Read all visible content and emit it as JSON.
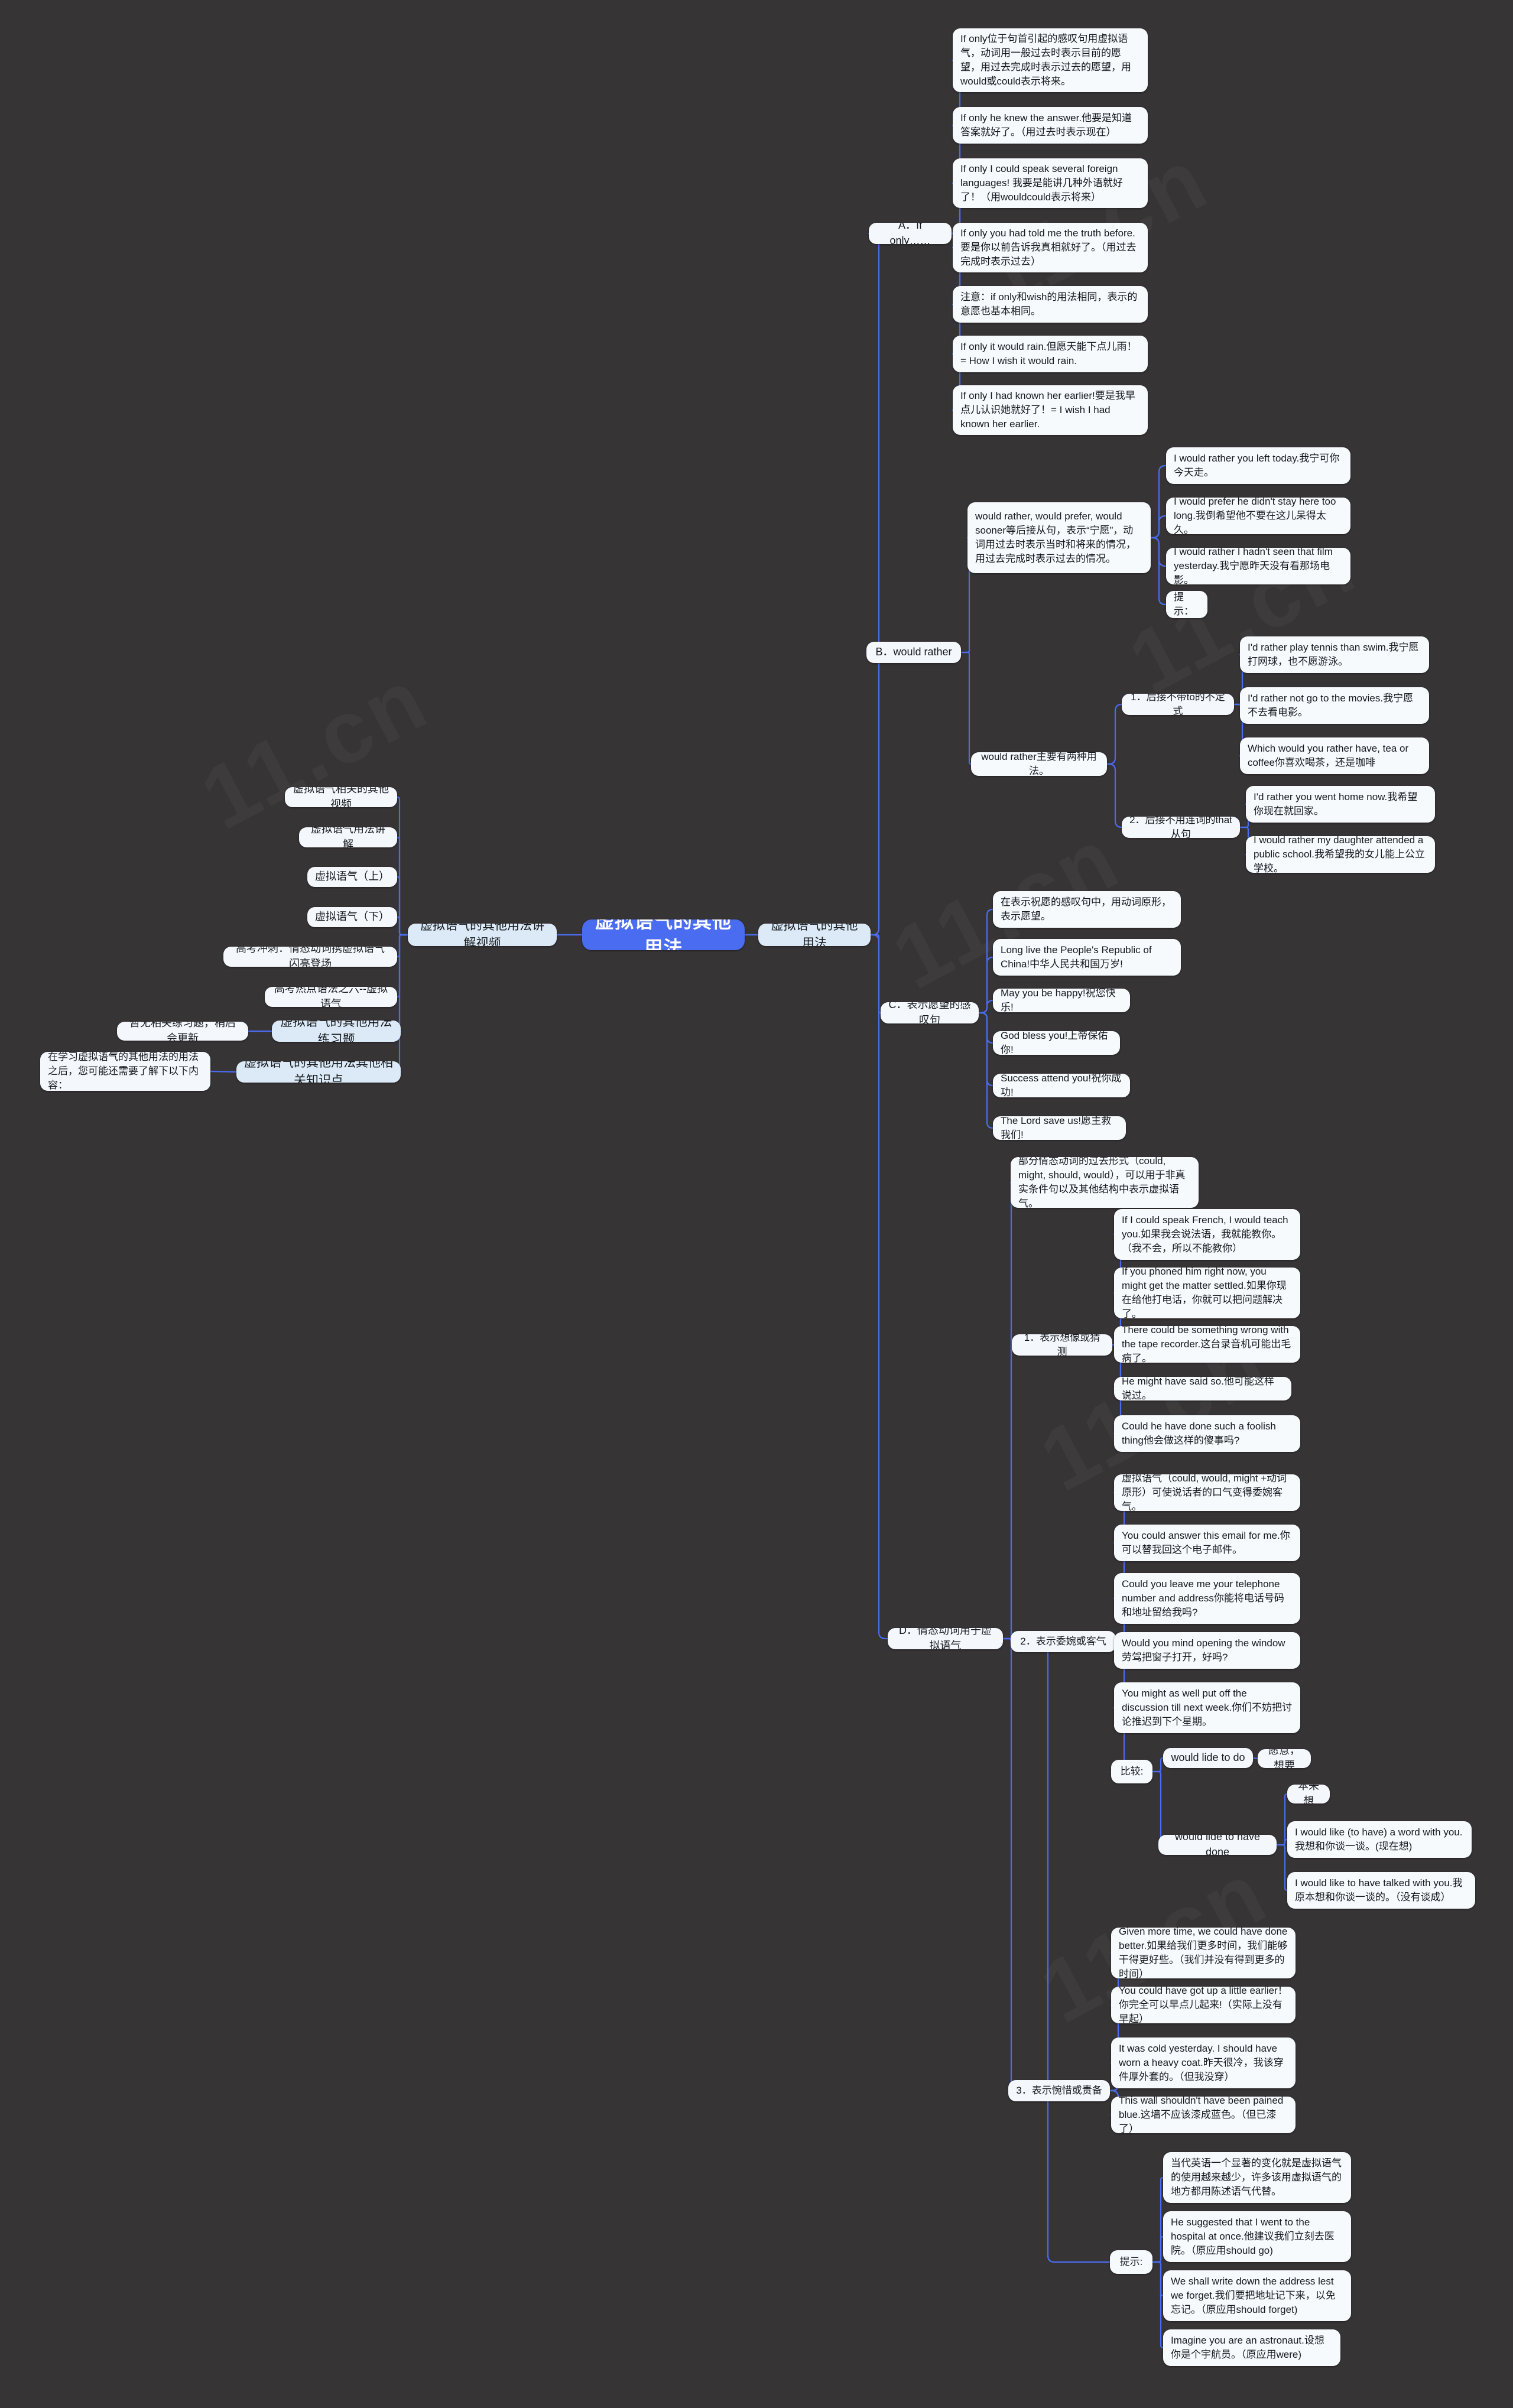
{
  "theme": {
    "background": "#373436",
    "root_fill": "#4a6cf0",
    "root_text": "#ffffff",
    "node_fill": "#f6fafd",
    "lvl1_fill": "#dceaf7",
    "link_color": "#4a6cf0",
    "text_color": "#15181c"
  },
  "watermark": "11.cn",
  "root": {
    "label": "虚拟语气的其他用法"
  },
  "left": {
    "video_hub": {
      "label": "虚拟语气的其他用法讲解视频"
    },
    "videos": [
      {
        "label": "虚拟语气相关的其他视频"
      },
      {
        "label": "虚拟语气用法讲解"
      },
      {
        "label": "虚拟语气（上）"
      },
      {
        "label": "虚拟语气（下）"
      },
      {
        "label": "高考冲刺：情态动词携虚拟语气闪亮登场"
      },
      {
        "label": "高考热点语法之六--虚拟语气"
      }
    ],
    "exercise": {
      "label": "虚拟语气的其他用法练习题",
      "child": "暂无相关练习题，稍后会更新"
    },
    "related": {
      "label": "虚拟语气的其他用法其他相关知识点",
      "child": "在学习虚拟语气的其他用法的用法之后，您可能还需要了解下以下内容："
    }
  },
  "right": {
    "hub": {
      "label": "虚拟语气的其他用法"
    },
    "branches": [
      {
        "id": "A",
        "label": "A．If only……",
        "items": [
          "If only位于句首引起的感叹句用虚拟语气，动词用一般过去时表示目前的愿望，用过去完成时表示过去的愿望，用would或could表示将来。",
          "If only he knew the answer.他要是知道答案就好了。（用过去时表示现在）",
          "If only I could speak several foreign languages! 我要是能讲几种外语就好了！（用wouldcould表示将来）",
          "If only you had told me the truth before.要是你以前告诉我真相就好了。（用过去完成时表示过去）",
          "注意：if only和wish的用法相同，表示的意愿也基本相同。",
          "If only it would rain.但愿天能下点儿雨！= How I wish it would rain.",
          "If only I had known her earlier!要是我早点儿认识她就好了！= I wish I had known her earlier."
        ]
      },
      {
        "id": "B",
        "label": "B．would rather",
        "groups": [
          {
            "label": "would rather, would prefer, would sooner等后接从句，表示“宁愿”，动词用过去时表示当时和将来的情况，用过去完成时表示过去的情况。",
            "items": [
              "I would rather you left today.我宁可你今天走。",
              "I would prefer he didn't stay here too long.我倒希望他不要在这儿呆得太久。",
              "I would rather I hadn't seen that film yesterday.我宁愿昨天没有看那场电影。",
              "提示："
            ]
          },
          {
            "label": "would rather主要有两种用法。",
            "subgroups": [
              {
                "label": "1．后接不带to的不定式",
                "items": [
                  "I'd rather play tennis than swim.我宁愿打网球，也不愿游泳。",
                  "I'd rather not go to the movies.我宁愿不去看电影。",
                  "Which would you rather have, tea or coffee你喜欢喝茶，还是咖啡"
                ]
              },
              {
                "label": "2．后接不用连词的that从句",
                "items": [
                  "I'd rather you went home now.我希望你现在就回家。",
                  "I would rather my daughter attended a public school.我希望我的女儿能上公立学校。"
                ]
              }
            ]
          }
        ]
      },
      {
        "id": "C",
        "label": "C．表示愿望的感叹句",
        "items": [
          "在表示祝愿的感叹句中，用动词原形，表示愿望。",
          "Long live the People's Republic of China!中华人民共和国万岁!",
          "May you be happy!祝您快乐!",
          "God bless you!上帝保佑你!",
          "Success attend you!祝你成功!",
          "The Lord save us!愿主救我们!"
        ]
      },
      {
        "id": "D",
        "label": "D．情态动词用于虚拟语气",
        "intro": "部分情态动词的过去形式（could, might, should, would），可以用于非真实条件句以及其他结构中表示虚拟语气。",
        "groups": [
          {
            "label": "1．表示想像或猜测",
            "items": [
              "If I could speak French, I would teach you.如果我会说法语，我就能教你。（我不会，所以不能教你）",
              "If you phoned him right now, you might get the matter settled.如果你现在给他打电话，你就可以把问题解决了。",
              "There could be something wrong with the tape recorder.这台录音机可能出毛病了。",
              "He might have said so.他可能这样说过。",
              "Could he have done such a foolish thing他会做这样的傻事吗?"
            ]
          },
          {
            "label": "2．表示委婉或客气",
            "items": [
              "虚拟语气（could, would, might +动词原形）可使说话者的口气变得委婉客气。",
              "You could answer this email for me.你可以替我回这个电子邮件。",
              "Could you leave me your telephone number and address你能将电话号码和地址留给我吗?",
              "Would you mind opening the window劳驾把窗子打开，好吗?",
              "You might as well put off the discussion till next week.你们不妨把讨论推迟到下个星期。"
            ],
            "compare": {
              "label": "比较:",
              "pairs": [
                {
                  "form": "would lide to do",
                  "meaning": "愿意，想要",
                  "examples": []
                },
                {
                  "form": "would lide to have done",
                  "meaning": "本来想",
                  "examples": [
                    "I would like (to have) a word with you.我想和你谈一谈。(现在想)",
                    "I would like to have talked with you.我原本想和你谈一谈的。（没有谈成）"
                  ]
                }
              ]
            }
          },
          {
            "label": "3．表示惋惜或责备",
            "items": [
              "Given more time, we could have done better.如果给我们更多时间，我们能够干得更好些。（我们并没有得到更多的时间）",
              "You could have got up a little earlier！你完全可以早点儿起来!（实际上没有早起）",
              "It was cold yesterday. I should have worn a heavy coat.昨天很冷，我该穿件厚外套的。（但我没穿）",
              "This wall shouldn't have been pained blue.这墙不应该漆成蓝色。（但已漆了）"
            ]
          },
          {
            "label": "提示:",
            "items": [
              "当代英语一个显著的变化就是虚拟语气的使用越来越少，许多该用虚拟语气的地方都用陈述语气代替。",
              "He suggested that I went to the hospital at once.他建议我们立刻去医院。（原应用should go)",
              "We shall write down the address lest we forget.我们要把地址记下来，以免忘记。（原应用should forget)",
              "Imagine you are an astronaut.设想你是个宇航员。（原应用were)"
            ]
          }
        ]
      }
    ]
  }
}
